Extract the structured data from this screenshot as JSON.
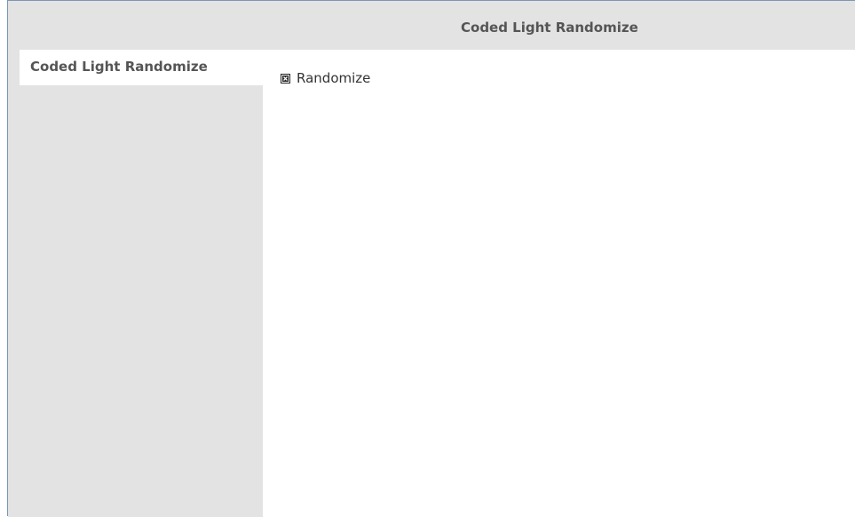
{
  "header": {
    "title": "Coded Light Randomize"
  },
  "sidebar": {
    "tabs": [
      {
        "label": "Coded Light Randomize",
        "active": true
      }
    ]
  },
  "main": {
    "options": [
      {
        "label": "Randomize",
        "checked": true,
        "icon": "checkbox-checked-icon"
      }
    ]
  },
  "colors": {
    "panel_gray": "#e3e3e3",
    "frame_border": "#7a96b8",
    "text": "#555555"
  }
}
